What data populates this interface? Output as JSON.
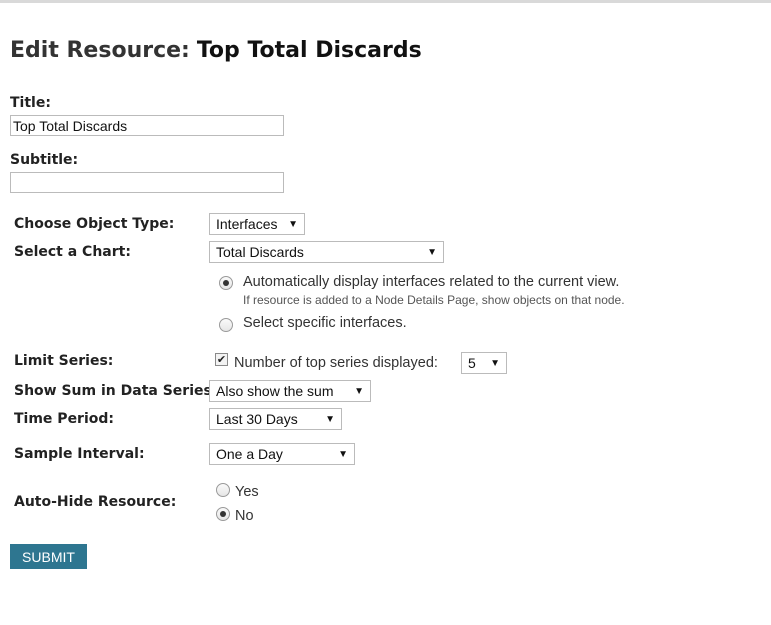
{
  "page": {
    "heading_prefix": "Edit Resource:",
    "heading_name": "Top Total Discards"
  },
  "title": {
    "label": "Title:",
    "value": "Top Total Discards"
  },
  "subtitle": {
    "label": "Subtitle:",
    "value": ""
  },
  "object_type": {
    "label": "Choose Object Type:",
    "selected": "Interfaces"
  },
  "chart": {
    "label": "Select a Chart:",
    "selected": "Total Discards"
  },
  "interface_mode": {
    "auto_label": "Automatically display interfaces related to the current view.",
    "auto_hint": "If resource is added to a Node Details Page, show objects on that node.",
    "specific_label": "Select specific interfaces.",
    "selected": "auto"
  },
  "limit_series": {
    "label": "Limit Series:",
    "checked": true,
    "check_label": "Number of top series displayed:",
    "count": "5"
  },
  "show_sum": {
    "label": "Show Sum in Data Series:",
    "selected": "Also show the sum"
  },
  "time_period": {
    "label": "Time Period:",
    "selected": "Last 30 Days"
  },
  "sample_interval": {
    "label": "Sample Interval:",
    "selected": "One a Day"
  },
  "auto_hide": {
    "label": "Auto-Hide Resource:",
    "yes_label": "Yes",
    "no_label": "No",
    "selected": "No"
  },
  "submit_label": "SUBMIT",
  "colors": {
    "submit_bg": "#2e7690",
    "top_bar": "#d9d9d9"
  },
  "icons": {
    "dropdown": "triangle-down",
    "check": "checkmark"
  }
}
